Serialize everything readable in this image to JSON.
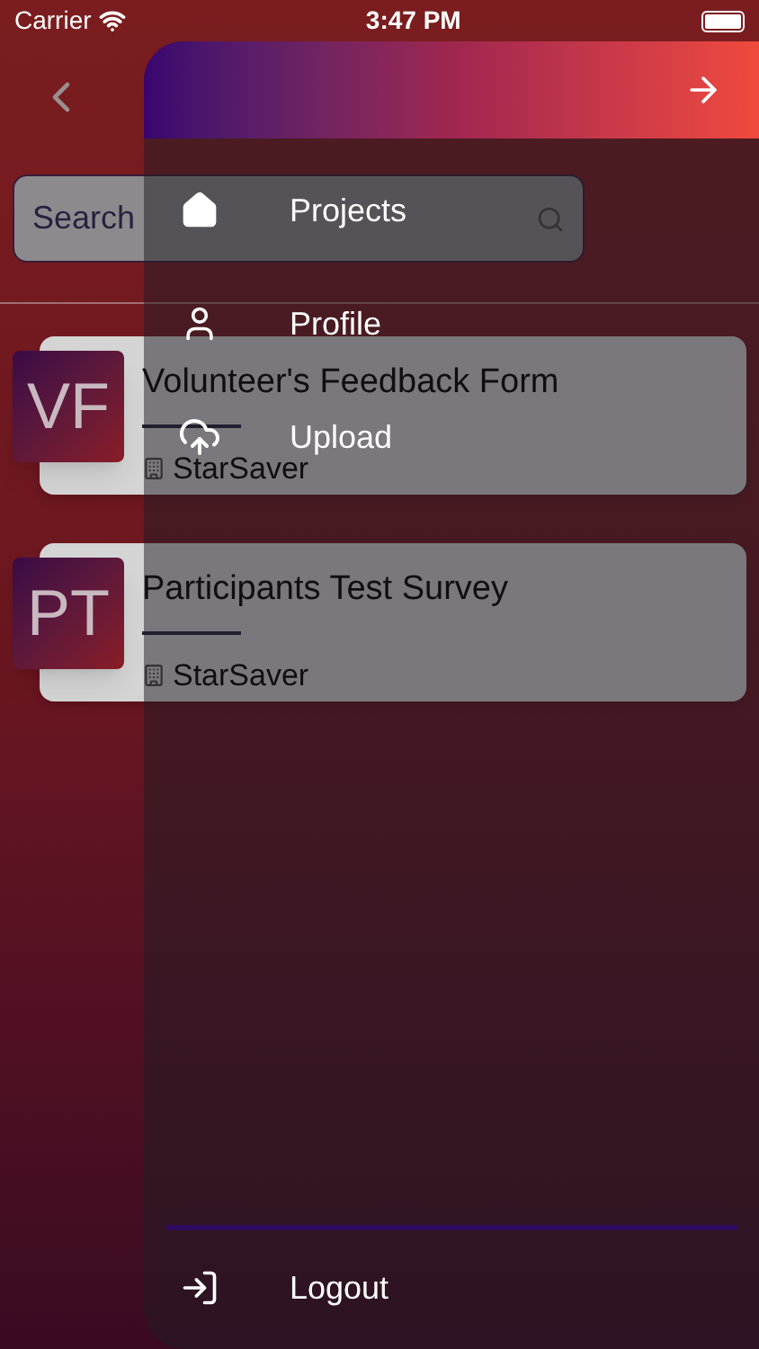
{
  "status_bar": {
    "carrier": "Carrier",
    "time": "3:47 PM"
  },
  "search": {
    "placeholder": "Search"
  },
  "projects": [
    {
      "initials": "VF",
      "title": "Volunteer's Feedback Form",
      "organization": "StarSaver"
    },
    {
      "initials": "PT",
      "title": "Participants Test Survey",
      "organization": "StarSaver"
    }
  ],
  "drawer": {
    "items": [
      {
        "kind": "home",
        "label": "Projects"
      },
      {
        "kind": "profile",
        "label": "Profile"
      },
      {
        "kind": "upload",
        "label": "Upload"
      }
    ],
    "logout": {
      "label": "Logout"
    }
  }
}
